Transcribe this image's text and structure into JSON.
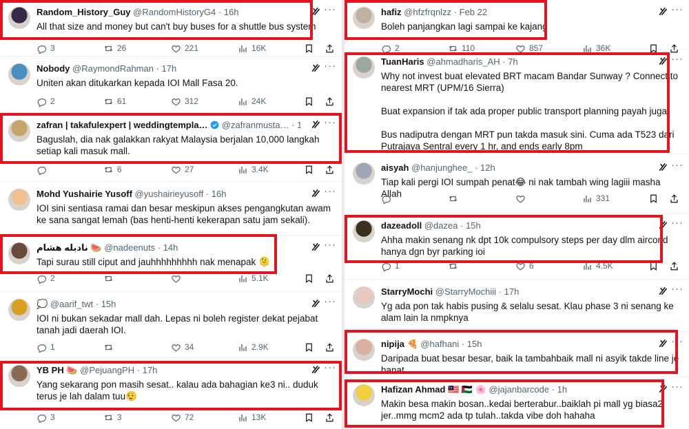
{
  "left_column": [
    {
      "name": "Random_History_Guy",
      "handle": "@RandomHistoryG4",
      "time": "16h",
      "text": "All that size and money but can't buy buses for a shuttle bus system",
      "replies": "3",
      "reposts": "26",
      "likes": "221",
      "views": "16K",
      "avatar_color": "#3a2a4a"
    },
    {
      "name": "Nobody",
      "handle": "@RaymondRahman",
      "time": "17h",
      "text": "Uniten akan ditukarkan kepada IOI Mall Fasa 20.",
      "replies": "2",
      "reposts": "61",
      "likes": "312",
      "views": "24K",
      "avatar_color": "#4a8fc0"
    },
    {
      "name": "zafran | takafulexpert | weddingtempla…",
      "handle": "@zafranmusta…",
      "time": "12h",
      "text": "Baguslah, dia nak galakkan rakyat Malaysia berjalan 10,000 langkah setiap kali masuk mall.",
      "replies": "",
      "reposts": "6",
      "likes": "27",
      "views": "3.4K",
      "avatar_color": "#c9a46a"
    },
    {
      "name": "Mohd Yushairie Yusoff",
      "handle": "@yushairieyusoff",
      "time": "16h",
      "text": "IOI sini sentiasa ramai dan besar meskipun akses pengangkutan awam ke sana sangat lemah (bas henti-henti kekerapan satu jam sekali).",
      "replies": "",
      "reposts": "",
      "likes": "",
      "views": "",
      "avatar_color": "#f0c090"
    },
    {
      "name": "نادبله هشام 🍉",
      "handle": "@nadeenuts",
      "time": "14h",
      "text": "Tapi surau still ciput and jauhhhhhhhhh nak menapak 🫠",
      "replies": "2",
      "reposts": "",
      "likes": "",
      "views": "5.1K",
      "avatar_color": "#6a4a3a"
    },
    {
      "name": "💭",
      "handle": "@aarif_twt",
      "time": "15h",
      "text": "IOI ni bukan sekadar mall dah. Lepas ni boleh register dekat pejabat tanah jadi daerah IOI.",
      "replies": "1",
      "reposts": "",
      "likes": "34",
      "views": "2.9K",
      "avatar_color": "#d9a020"
    },
    {
      "name": "YB PH 🍉",
      "handle": "@PejuangPH",
      "time": "17h",
      "text": "Yang sekarang pon masih sesat.. kalau ada bahagian ke3 ni.. duduk terus je lah dalam tuu😮‍💨",
      "replies": "3",
      "reposts": "3",
      "likes": "72",
      "views": "13K",
      "avatar_color": "#8a6a50"
    }
  ],
  "right_column": [
    {
      "name": "hafiz",
      "handle": "@hfzfrqnlzz",
      "time": "Feb 22",
      "text": "Boleh panjangkan lagi sampai ke kajang",
      "replies": "2",
      "reposts": "110",
      "likes": "857",
      "views": "36K",
      "avatar_color": "#c0b0a0"
    },
    {
      "name": "TuanHaris",
      "handle": "@ahmadharis_AH",
      "time": "7h",
      "text": "Why not invest buat elevated BRT macam Bandar Sunway ? Connect to nearest MRT (UPM/16 Sierra)\n\nBuat expansion if tak ada proper public transport planning payah juga\n\nBus nadiputra dengan MRT pun takda masuk sini. Cuma ada T523 dari Putrajaya Sentral every 1 hr, and ends early 8pm",
      "replies": "",
      "reposts": "",
      "likes": "",
      "views": "",
      "avatar_color": "#9aa8a0"
    },
    {
      "name": "aisyah",
      "handle": "@hanjunghee_",
      "time": "12h",
      "text": "Tiap kali pergi IOI sumpah penat😂 ni nak tambah wing lagiii masha Allah",
      "replies": "",
      "reposts": "",
      "likes": "",
      "views": "331",
      "avatar_color": "#a0a8b8"
    },
    {
      "name": "dazeadoll",
      "handle": "@dazea",
      "time": "15h",
      "text": "Ahha makin senang nk dpt 10k compulsory steps per day dlm aircond hanya dgn byr parking ioi",
      "replies": "1",
      "reposts": "",
      "likes": "6",
      "views": "4.5K",
      "avatar_color": "#3a3020"
    },
    {
      "name": "StarryMochi",
      "handle": "@StarryMochiii",
      "time": "17h",
      "text": "Yg ada pon tak habis pusing & selalu sesat. Klau phase 3 ni senang ke alam lain la nmpknya",
      "replies": "",
      "reposts": "",
      "likes": "",
      "views": "",
      "avatar_color": "#e8c8c0"
    },
    {
      "name": "nipija 🍕",
      "handle": "@hafhani",
      "time": "15h",
      "text": "Daripada buat besar besar, baik la tambahbaik mall ni asyik takde line je hanat",
      "replies": "",
      "reposts": "",
      "likes": "",
      "views": "",
      "avatar_color": "#d8b0a0"
    },
    {
      "name": "Hafizan Ahmad 🇲🇾 🇵🇸 🌸",
      "handle": "@jajanbarcode",
      "time": "1h",
      "text": "Makin besa makin bosan..kedai berterabur..baiklah pi mall yg biasa2 jer..mmg mcm2 ada tp tulah..takda vibe doh hahaha",
      "replies": "",
      "reposts": "",
      "likes": "",
      "views": "",
      "avatar_color": "#f0d040"
    }
  ],
  "colors": {
    "highlight": "#e3131f",
    "secondary_text": "#536471",
    "verified": "#1d9bf0"
  },
  "icons": [
    "reply-icon",
    "repost-icon",
    "like-icon",
    "views-icon",
    "bookmark-icon",
    "share-icon",
    "grok-icon",
    "more-icon",
    "verified-badge-icon"
  ]
}
